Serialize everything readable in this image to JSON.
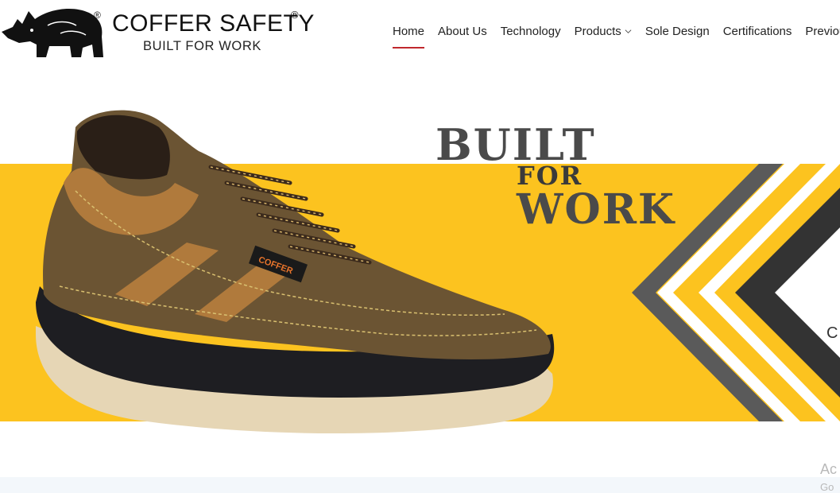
{
  "brand": {
    "name": "COFFER SAFETY",
    "registered_mark": "®",
    "tagline": "BUILT FOR WORK"
  },
  "nav": {
    "items": [
      {
        "label": "Home",
        "active": true
      },
      {
        "label": "About Us"
      },
      {
        "label": "Technology"
      },
      {
        "label": "Products",
        "dropdown": true
      },
      {
        "label": "Sole Design"
      },
      {
        "label": "Certifications"
      },
      {
        "label": "Previou"
      }
    ]
  },
  "hero": {
    "line1": "BUILT",
    "line2": "FOR",
    "line3": "WORK",
    "shoe_label": "COFFER",
    "partial_letter": "C",
    "band_color": "#fcc31f"
  },
  "watermark": {
    "line1": "Ac",
    "line2": "Go"
  }
}
